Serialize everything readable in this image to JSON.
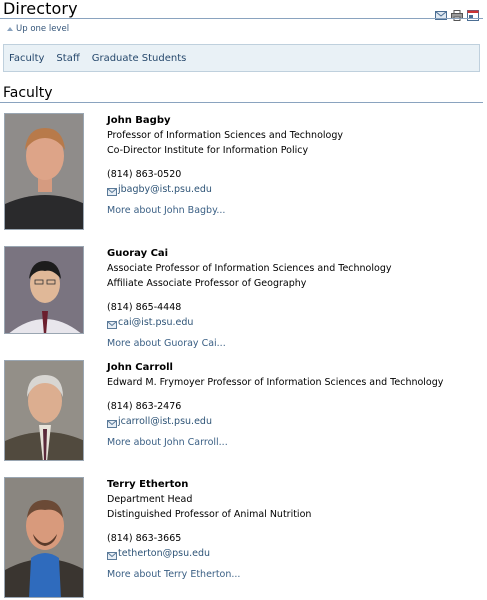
{
  "header": {
    "title": "Directory",
    "actions": [
      "send-page-icon",
      "print-icon",
      "fullscreen-icon"
    ],
    "up_one_level": "Up one level"
  },
  "tabs": [
    "Faculty",
    "Staff",
    "Graduate Students"
  ],
  "section_title": "Faculty",
  "colors": {
    "link": "#2d5376",
    "tab_bg": "#e9f1f6",
    "rule": "#8aa3bf"
  },
  "people": [
    {
      "name": "John Bagby",
      "titles": [
        "Professor of Information Sciences and Technology",
        "Co-Director Institute for Information Policy"
      ],
      "phone": "(814) 863-0520",
      "email": "jbagby@ist.psu.edu",
      "more": "More about John Bagby..."
    },
    {
      "name": "Guoray Cai",
      "titles": [
        "Associate Professor of Information Sciences and Technology",
        "Affiliate Associate Professor of Geography"
      ],
      "phone": "(814) 865-4448",
      "email": "cai@ist.psu.edu",
      "more": "More about Guoray Cai..."
    },
    {
      "name": "John Carroll",
      "titles": [
        "Edward M. Frymoyer Professor of Information Sciences and Technology"
      ],
      "phone": "(814) 863-2476",
      "email": "jcarroll@ist.psu.edu",
      "more": "More about John Carroll..."
    },
    {
      "name": "Terry Etherton",
      "titles": [
        "Department Head",
        "Distinguished Professor of Animal Nutrition"
      ],
      "phone": "(814) 863-3665",
      "email": "tetherton@psu.edu",
      "more": "More about Terry Etherton..."
    }
  ]
}
